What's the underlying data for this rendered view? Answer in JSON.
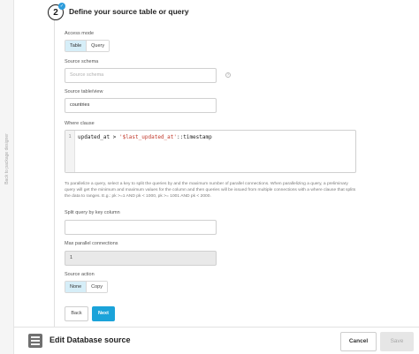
{
  "sidebar": {
    "back_link": "Back to package designer"
  },
  "step": {
    "number": "2",
    "check": "✓",
    "title": "Define your source table or query"
  },
  "form": {
    "access_mode": {
      "label": "Access mode",
      "options": [
        "Table",
        "Query"
      ],
      "selected": "Table"
    },
    "source_schema": {
      "label": "Source schema",
      "placeholder": "Source schema",
      "info": "?"
    },
    "source_table": {
      "label": "Source table/view",
      "value": "countries"
    },
    "where_clause": {
      "label": "Where clause",
      "line_number": "1",
      "code_prefix": "updated_at > ",
      "code_string": "'$last_updated_at'",
      "code_suffix": "::timestamp"
    },
    "help_text": "To parallelize a query, select a key to split the queries by and the maximum number of parallel connections. When parallelizing a query, a preliminary query will get the minimum and maximum values for the column and then queries will be issued from multiple connections with a where clause that splits the data to ranges. E.g.: pk >=1 AND pk < 1000, pk >= 1001 AND pk < 2000.",
    "split_key": {
      "label": "Split query by key column",
      "value": ""
    },
    "max_connections": {
      "label": "Max parallel connections",
      "value": "1"
    },
    "source_action": {
      "label": "Source action",
      "options": [
        "None",
        "Copy"
      ],
      "selected": "None"
    }
  },
  "nav": {
    "back": "Back",
    "next": "Next"
  },
  "footer": {
    "title": "Edit Database source",
    "icon": "database-icon",
    "cancel": "Cancel",
    "save": "Save"
  },
  "colors": {
    "accent": "#1ba3d9",
    "toggle_active": "#d6eef8",
    "step_check": "#2d9cdb"
  }
}
